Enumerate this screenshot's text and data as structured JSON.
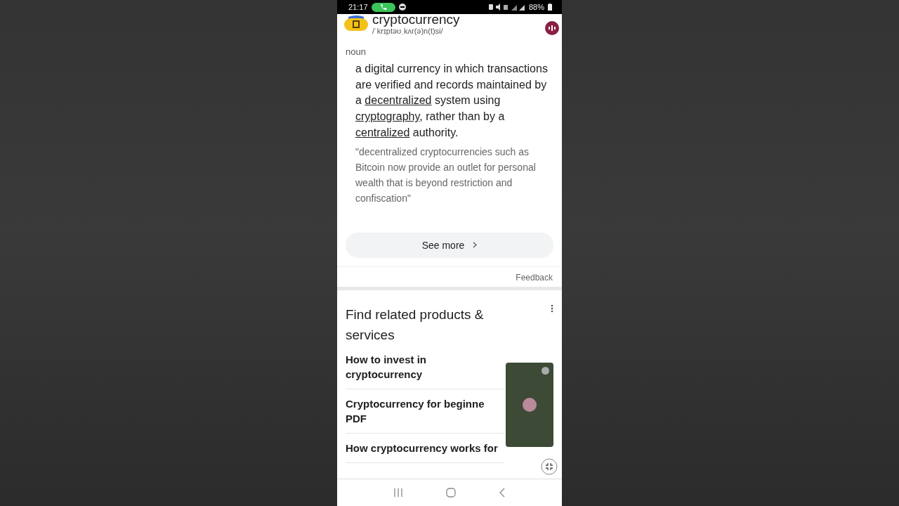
{
  "status_bar": {
    "time": "21:17",
    "battery": "88%"
  },
  "entry": {
    "word": "cryptocurrency",
    "pronunciation": "/ˈkrɪptəʊˌkʌr(ə)n(t)si/",
    "part_of_speech": "noun",
    "definition": [
      {
        "kind": "text",
        "text": "a digital currency in which transactions are verified and records maintained by a "
      },
      {
        "kind": "link",
        "text": "decentralized"
      },
      {
        "kind": "text",
        "text": " system using "
      },
      {
        "kind": "link",
        "text": "cryptography"
      },
      {
        "kind": "text",
        "text": ", rather than by a "
      },
      {
        "kind": "link",
        "text": "centralized"
      },
      {
        "kind": "text",
        "text": " authority."
      }
    ],
    "example": "\"decentralized cryptocurrencies such as Bitcoin now provide an outlet for personal wealth that is beyond restriction and confiscation\"",
    "see_more": "See more",
    "feedback": "Feedback"
  },
  "related": {
    "title": "Find related products & services",
    "items": [
      {
        "text": "How to invest in cryptocurrency"
      },
      {
        "text": "Cryptocurrency for beginne PDF"
      },
      {
        "text": "How cryptocurrency works for"
      }
    ]
  }
}
